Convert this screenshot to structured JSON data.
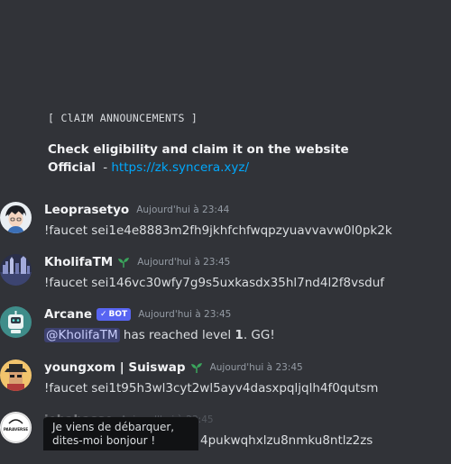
{
  "announcement": {
    "tag": "[ ClAIM ANNOUNCEMENTS ]",
    "headline": "Check eligibility and claim it on the website",
    "official_label": "Official",
    "separator": "-",
    "link": "https://zk.syncera.xyz/"
  },
  "messages": [
    {
      "username": "Leoprasetyo",
      "timestamp": "Aujourd'hui à 23:44",
      "content": "!faucet sei1e4e8883m2fh9jkhfchfwqpzyuavvavw0l0pk2k"
    },
    {
      "username": "KholifaTM",
      "timestamp": "Aujourd'hui à 23:45",
      "content": "!faucet sei146vc30wfy7g9s5uxkasdx35hl7nd4l2f8vsduf"
    },
    {
      "username": "Arcane",
      "badge": "BOT",
      "timestamp": "Aujourd'hui à 23:45",
      "mention": "@KholifaTM",
      "content_mid": " has reached level ",
      "level": "1",
      "content_end": ". GG!"
    },
    {
      "username": "youngxom | Suiswap",
      "timestamp": "Aujourd'hui à 23:45",
      "content": "!faucet sei1t95h3wl3cyt2wl5ayv4dasxpqljqlh4f0qutsm"
    },
    {
      "username": "jehahasse",
      "timestamp": "Aujourd'hui à 23:45",
      "content_partial": "4pukwqhxlzu8nmku8ntlz2zs",
      "avatar_text": "PARAVERSE"
    }
  ],
  "tooltip": {
    "line1": "Je viens de débarquer,",
    "line2": "dites-moi bonjour !"
  },
  "colors": {
    "background": "#313338",
    "link": "#00a8fc",
    "bot_badge": "#5865f2",
    "sprout": "#3ba55c"
  }
}
